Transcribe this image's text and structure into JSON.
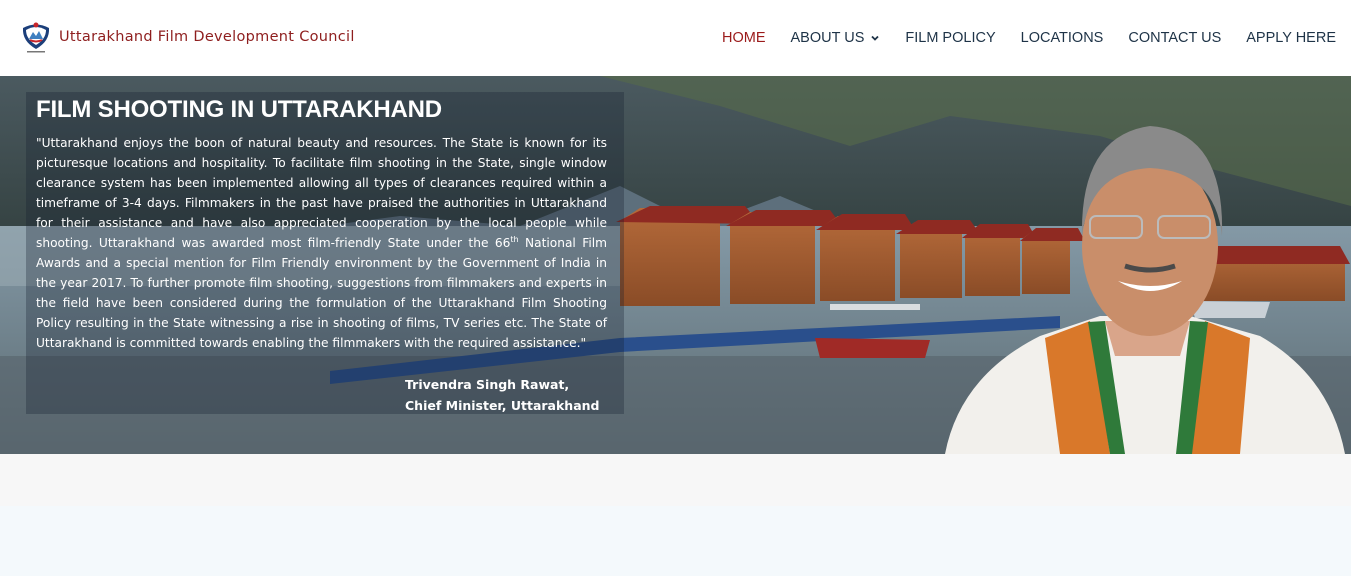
{
  "brand": {
    "name": "Uttarakhand Film Development Council",
    "logo_icon": "state-emblem-icon"
  },
  "nav": {
    "items": [
      {
        "label": "HOME",
        "active": true
      },
      {
        "label": "ABOUT US",
        "has_dropdown": true
      },
      {
        "label": "FILM POLICY"
      },
      {
        "label": "LOCATIONS"
      },
      {
        "label": "CONTACT US"
      },
      {
        "label": "APPLY HERE"
      }
    ]
  },
  "hero": {
    "title": "FILM SHOOTING IN UTTARAKHAND",
    "quote_part1": "\"Uttarakhand enjoys the boon of natural beauty and resources. The State is known for its picturesque locations and hospitality. To facilitate film shooting in the State, single window clearance system has been implemented allowing all types of clearances required within a timeframe of 3-4 days. Filmmakers in the past have praised the authorities in Uttarakhand for their assistance and have also appreciated cooperation by the local people while shooting. Uttarakhand was awarded most film-friendly State under the 66",
    "quote_sup": "th",
    "quote_part2": " National Film Awards and a special mention for Film Friendly environment by the Government of India in the year 2017. To further promote film shooting, suggestions from filmmakers and experts in the field have been considered during the formulation of the Uttarakhand Film Shooting Policy resulting in the State witnessing a rise in shooting of films, TV series etc. The State of Uttarakhand is committed towards enabling the filmmakers with the required assistance.\"",
    "signature_name": "Trivendra Singh Rawat,",
    "signature_title": "Chief Minister, Uttarakhand"
  },
  "colors": {
    "brand": "#8e1e1e",
    "nav_active": "#9b1b1b",
    "nav_text": "#1e3347"
  }
}
